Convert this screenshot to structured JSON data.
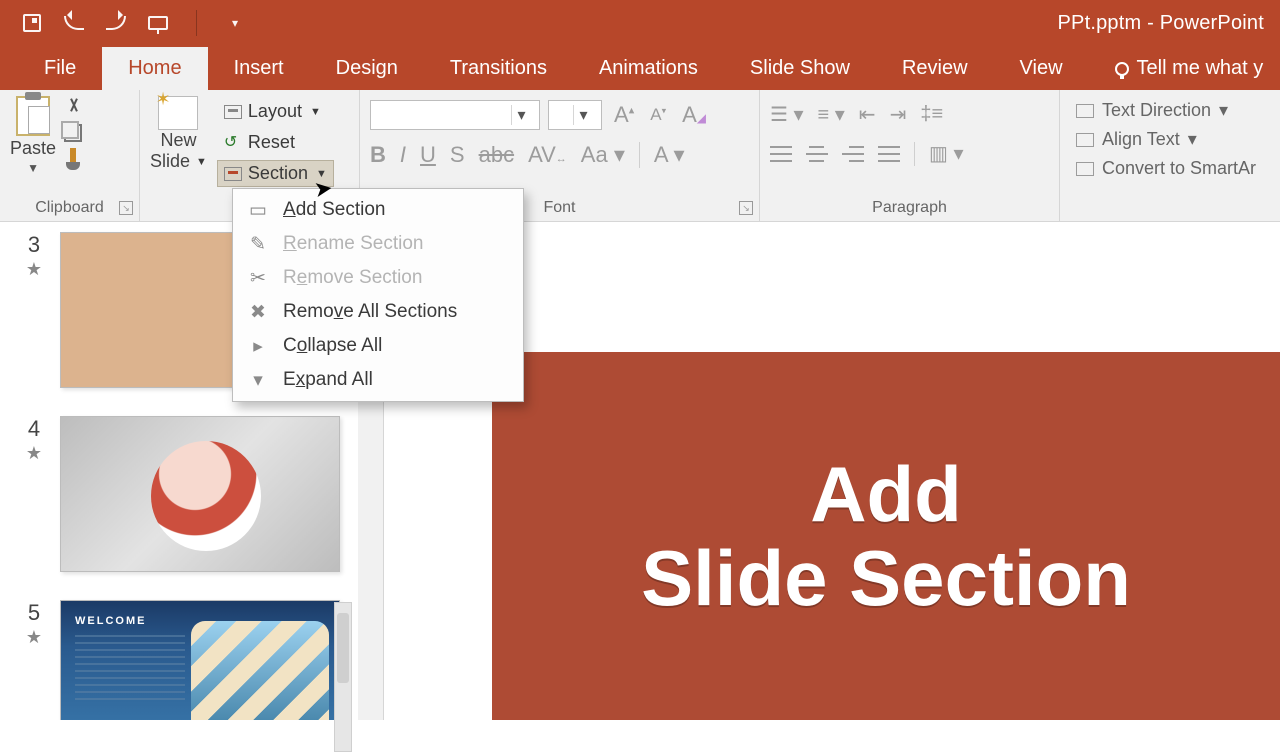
{
  "app": {
    "title": "PPt.pptm  -  PowerPoint"
  },
  "tabs": {
    "file": "File",
    "home": "Home",
    "insert": "Insert",
    "design": "Design",
    "transitions": "Transitions",
    "animations": "Animations",
    "slideshow": "Slide Show",
    "review": "Review",
    "view": "View",
    "tellme": "Tell me what y"
  },
  "ribbon": {
    "clipboard": {
      "label": "Clipboard",
      "paste": "Paste"
    },
    "slides": {
      "new_top": "New",
      "new_bottom": "Slide",
      "layout": "Layout",
      "reset": "Reset",
      "section": "Section"
    },
    "font": {
      "label": "Font"
    },
    "paragraph": {
      "label": "Paragraph"
    },
    "extra": {
      "textdir": "Text Direction",
      "align": "Align Text",
      "convert": "Convert to SmartAr"
    }
  },
  "section_menu": {
    "add_pre": "",
    "add_u": "A",
    "add_post": "dd Section",
    "rename_pre": "",
    "rename_u": "R",
    "rename_post": "ename Section",
    "remove_pre": "R",
    "remove_u": "e",
    "remove_post": "move Section",
    "removeall_pre": "Remo",
    "removeall_u": "v",
    "removeall_post": "e All Sections",
    "collapse_pre": "C",
    "collapse_u": "o",
    "collapse_post": "llapse All",
    "expand_pre": "E",
    "expand_u": "x",
    "expand_post": "pand All"
  },
  "thumbnails": {
    "n3": "3",
    "n4": "4",
    "n5": "5",
    "welcome": "WELCOME"
  },
  "canvas": {
    "line1": "Add",
    "line2": "Slide Section"
  }
}
